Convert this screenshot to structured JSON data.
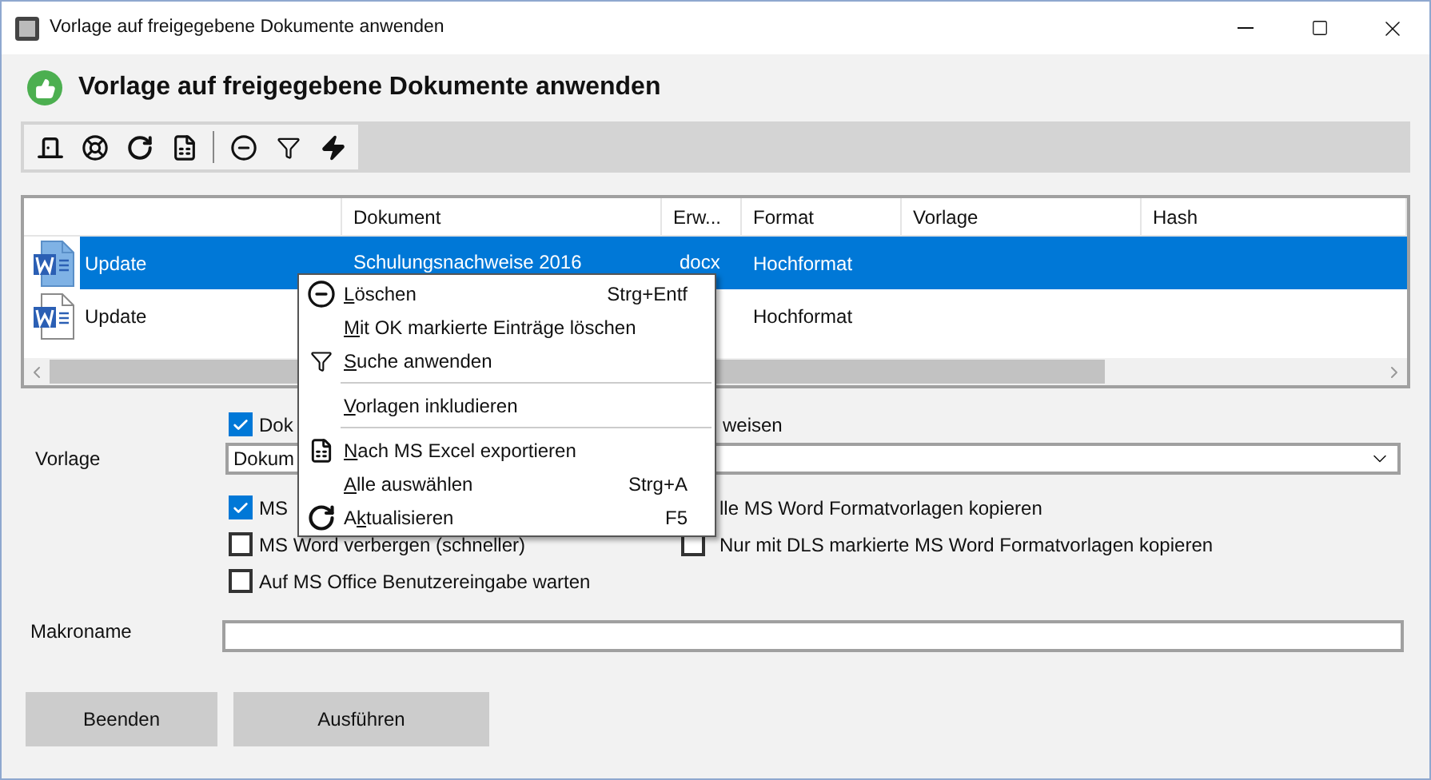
{
  "window": {
    "title": "Vorlage auf freigegebene Dokumente anwenden"
  },
  "header": {
    "title": "Vorlage auf freigegebene Dokumente anwenden"
  },
  "toolbar": [
    {
      "kind": "exit"
    },
    {
      "kind": "reset"
    },
    {
      "kind": "refresh"
    },
    {
      "kind": "export"
    },
    {
      "kind": "separator"
    },
    {
      "kind": "delete"
    },
    {
      "kind": "filter"
    },
    {
      "kind": "run"
    }
  ],
  "table": {
    "columns": [
      "Dokument",
      "Erw...",
      "Format",
      "Vorlage",
      "Hash"
    ],
    "rows": [
      {
        "selected": true,
        "name": "Update",
        "dokument": "Schulungsnachweise 2016",
        "erw": "docx",
        "format": "Hochformat"
      },
      {
        "selected": false,
        "name": "Update",
        "format": "Hochformat"
      }
    ]
  },
  "context_menu": [
    {
      "kind": "delete",
      "accel": "L",
      "after": "öschen",
      "shortcut": "Strg+Entf"
    },
    {
      "kind": "plain",
      "accel": "M",
      "after": "it OK markierte Einträge löschen"
    },
    {
      "kind": "filter",
      "accel": "S",
      "after": "uche anwenden"
    },
    {
      "kind": "separator"
    },
    {
      "kind": "plain",
      "accel": "V",
      "after": "orlagen inkludieren"
    },
    {
      "kind": "separator"
    },
    {
      "kind": "export",
      "accel": "N",
      "after": "ach MS Excel exportieren"
    },
    {
      "kind": "plain",
      "accel": "A",
      "after": "lle auswählen",
      "shortcut": "Strg+A"
    },
    {
      "kind": "refresh",
      "before": "A",
      "accel": "k",
      "after": "tualisieren",
      "shortcut": "F5"
    }
  ],
  "form": {
    "top_checkbox": {
      "checked": true,
      "label_start": "Dok",
      "label_end": "weisen"
    },
    "vorlage": {
      "label": "Vorlage",
      "value": "Dokum"
    },
    "options": [
      [
        {
          "checked": true,
          "label": "MS"
        },
        {
          "label": "lle MS Word Formatvorlagen kopieren"
        }
      ],
      [
        {
          "checked": false,
          "label": "MS Word verbergen (schneller)"
        },
        {
          "checked": false,
          "label": "Nur mit DLS markierte MS Word Formatvorlagen kopieren"
        }
      ],
      [
        {
          "checked": false,
          "label": "Auf MS Office Benutzereingabe warten"
        }
      ]
    ],
    "makroname": {
      "label": "Makroname"
    }
  },
  "buttons": [
    "Beenden",
    "Ausführen"
  ]
}
